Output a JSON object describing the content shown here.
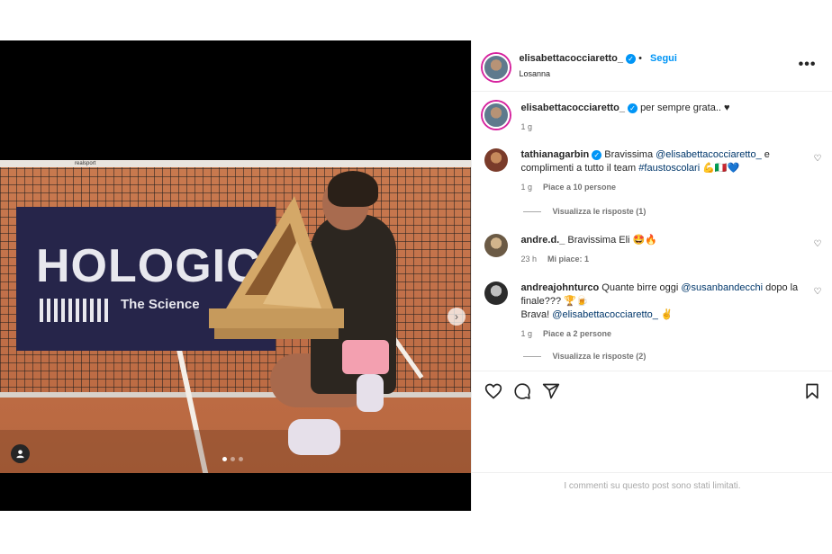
{
  "post": {
    "author": {
      "username": "elisabettacocciaretto_",
      "follow_label": "Segui",
      "location": "Losanna",
      "dot": "•"
    },
    "more_label": "•••",
    "caption": {
      "username": "elisabettacocciaretto_",
      "text": "per sempre grata.. ♥",
      "time": "1 g"
    },
    "media": {
      "banner_title": "HOLOGIC",
      "banner_subtitle": "The Science",
      "net_brand": "realsport",
      "slide_count": 3,
      "active_slide": 1
    },
    "comments": [
      {
        "username": "tathianagarbin",
        "verified": true,
        "text_parts": [
          {
            "t": "Bravissima ",
            "mention": false
          },
          {
            "t": "@elisabettacocciaretto_",
            "mention": true
          },
          {
            "t": " e complimenti a tutto il team ",
            "mention": false
          },
          {
            "t": "#faustoscolari",
            "mention": true
          },
          {
            "t": " 💪🇮🇹💙",
            "mention": false
          }
        ],
        "time": "1 g",
        "likes": "Piace a 10 persone",
        "replies": "Visualizza le risposte (1)"
      },
      {
        "username": "andre.d._",
        "verified": false,
        "text_parts": [
          {
            "t": "Bravissima Eli 🤩🔥",
            "mention": false
          }
        ],
        "time": "23 h",
        "likes": "Mi piace: 1",
        "replies": ""
      },
      {
        "username": "andreajohnturco",
        "verified": false,
        "text_parts": [
          {
            "t": "Quante birre oggi ",
            "mention": false
          },
          {
            "t": "@susanbandecchi",
            "mention": true
          },
          {
            "t": " dopo la finale??? 🏆🍺",
            "mention": false
          },
          {
            "t": " Brava! ",
            "mention": false
          },
          {
            "t": "@elisabettacocciaretto_",
            "mention": true
          },
          {
            "t": " ✌",
            "mention": false
          }
        ],
        "time": "1 g",
        "likes": "Piace a 2 persone",
        "replies": "Visualizza le risposte (2)"
      }
    ],
    "actions": [
      "heart-icon",
      "comment-icon",
      "share-icon",
      "save-icon"
    ],
    "comments_limited": "I commenti su questo post sono stati limitati.",
    "colors": {
      "accent": "#0095f6",
      "mention": "#00376b",
      "muted": "#737373"
    }
  }
}
